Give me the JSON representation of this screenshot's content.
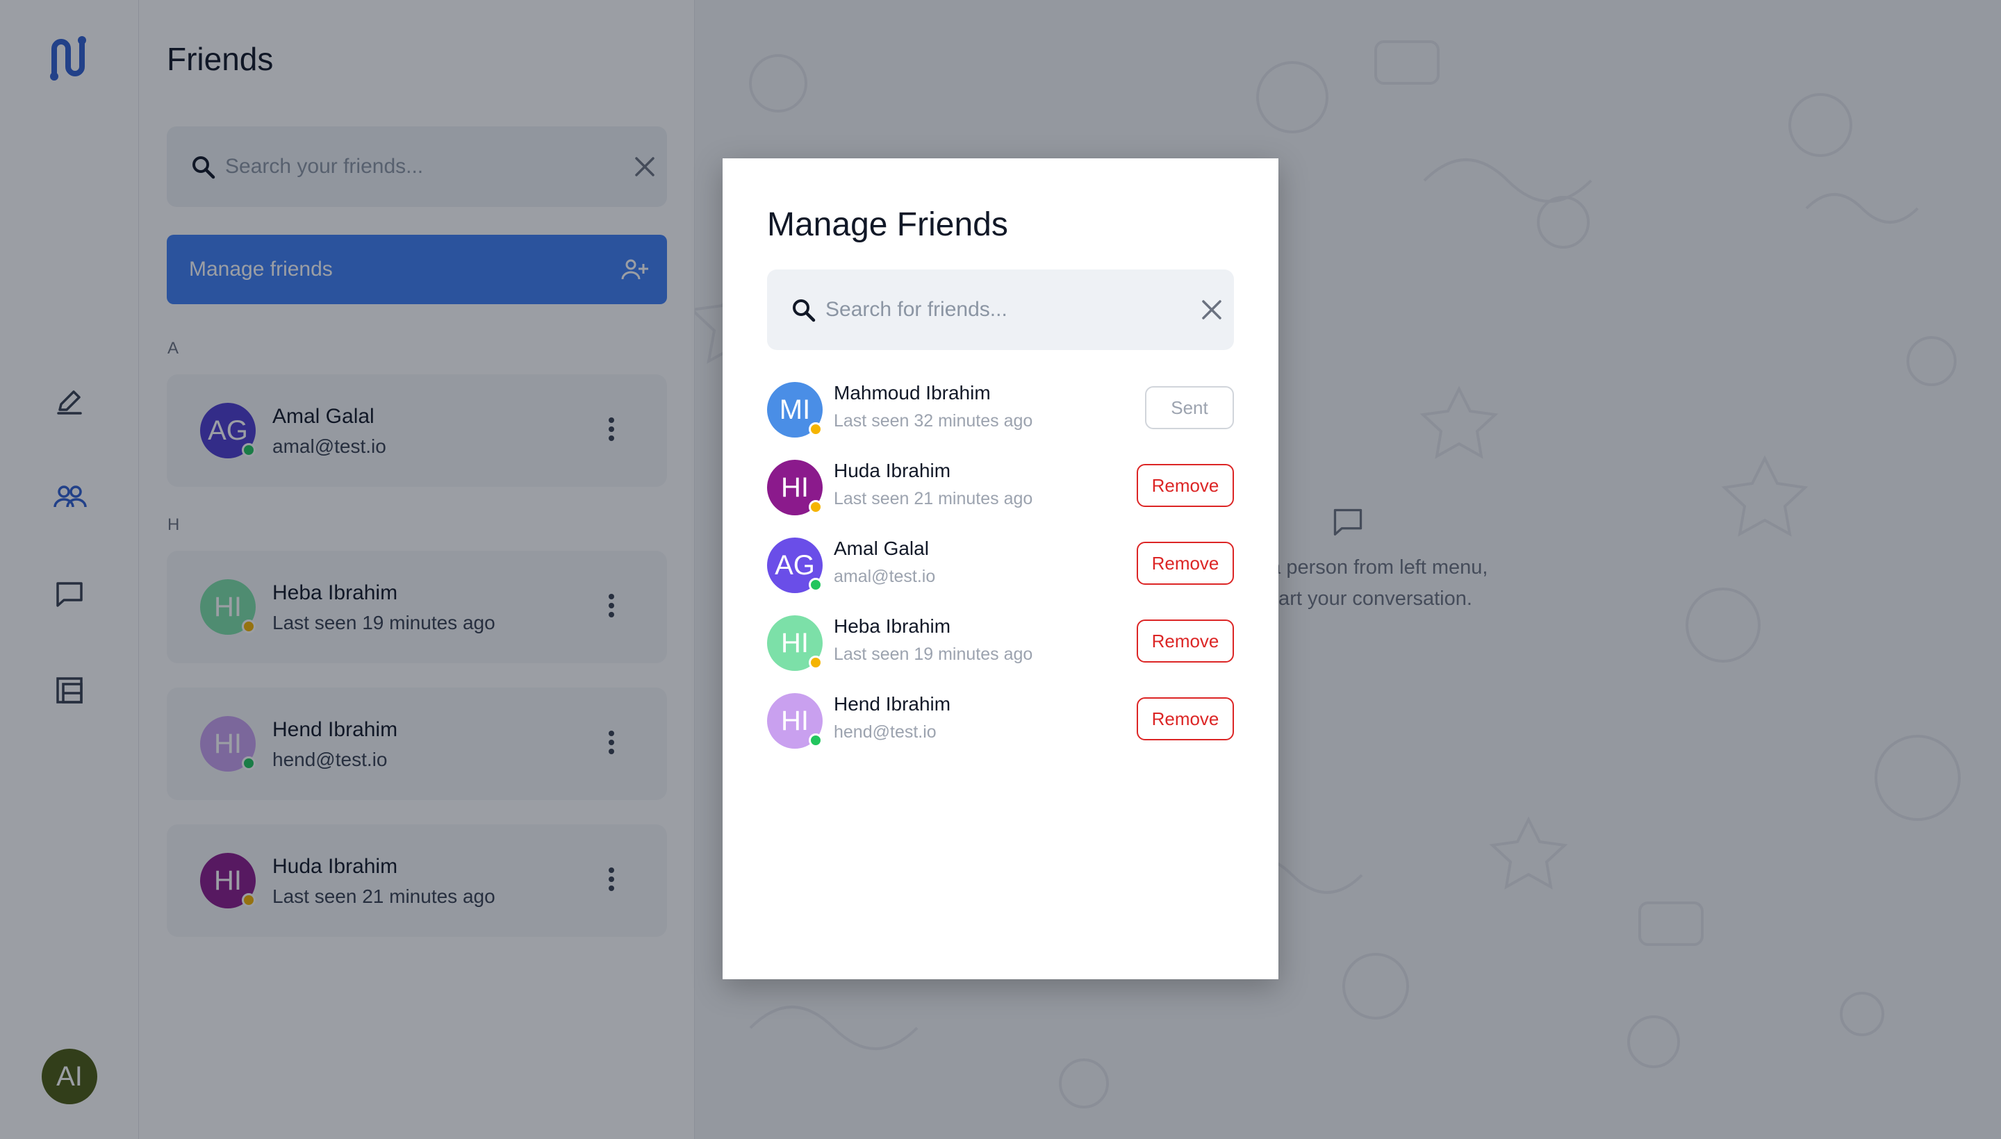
{
  "colors": {
    "accent": "#3f7ff3",
    "online": "#22c55e",
    "away": "#f5b400",
    "danger": "#dc2626"
  },
  "rail": {
    "icons": [
      "app-logo-icon",
      "pen-icon",
      "people-icon",
      "chat-bubble-icon",
      "layout-icon"
    ],
    "user_initials": "AI"
  },
  "friends_panel": {
    "title": "Friends",
    "search": {
      "placeholder": "Search your friends...",
      "value": ""
    },
    "manage_button_label": "Manage friends",
    "groups": [
      {
        "letter": "A",
        "friends": [
          {
            "initials": "AG",
            "name": "Amal Galal",
            "sub": "amal@test.io",
            "avatar_color": "#4c3bcf",
            "status": "online"
          }
        ]
      },
      {
        "letter": "H",
        "friends": [
          {
            "initials": "HI",
            "name": "Heba Ibrahim",
            "sub": "Last seen 19 minutes ago",
            "avatar_color": "#7ce0a8",
            "status": "away"
          },
          {
            "initials": "HI",
            "name": "Hend Ibrahim",
            "sub": "hend@test.io",
            "avatar_color": "#c9a0ef",
            "status": "online"
          },
          {
            "initials": "HI",
            "name": "Huda Ibrahim",
            "sub": "Last seen 21 minutes ago",
            "avatar_color": "#8b1a8c",
            "status": "away"
          }
        ]
      }
    ]
  },
  "chat_area": {
    "empty_line_1": "Select a person from left menu,",
    "empty_line_2": "and start your conversation."
  },
  "modal": {
    "title": "Manage Friends",
    "search": {
      "placeholder": "Search for friends...",
      "value": ""
    },
    "friends": [
      {
        "initials": "MI",
        "name": "Mahmoud Ibrahim",
        "sub": "Last seen 32 minutes ago",
        "avatar_color": "#4a8ee6",
        "status": "away",
        "action": "Sent",
        "action_type": "sent"
      },
      {
        "initials": "HI",
        "name": "Huda Ibrahim",
        "sub": "Last seen 21 minutes ago",
        "avatar_color": "#8b1a8c",
        "status": "away",
        "action": "Remove",
        "action_type": "remove"
      },
      {
        "initials": "AG",
        "name": "Amal Galal",
        "sub": "amal@test.io",
        "avatar_color": "#6a4ee8",
        "status": "online",
        "action": "Remove",
        "action_type": "remove"
      },
      {
        "initials": "HI",
        "name": "Heba Ibrahim",
        "sub": "Last seen 19 minutes ago",
        "avatar_color": "#7ce0a8",
        "status": "away",
        "action": "Remove",
        "action_type": "remove"
      },
      {
        "initials": "HI",
        "name": "Hend Ibrahim",
        "sub": "hend@test.io",
        "avatar_color": "#c9a0ef",
        "status": "online",
        "action": "Remove",
        "action_type": "remove"
      }
    ]
  }
}
